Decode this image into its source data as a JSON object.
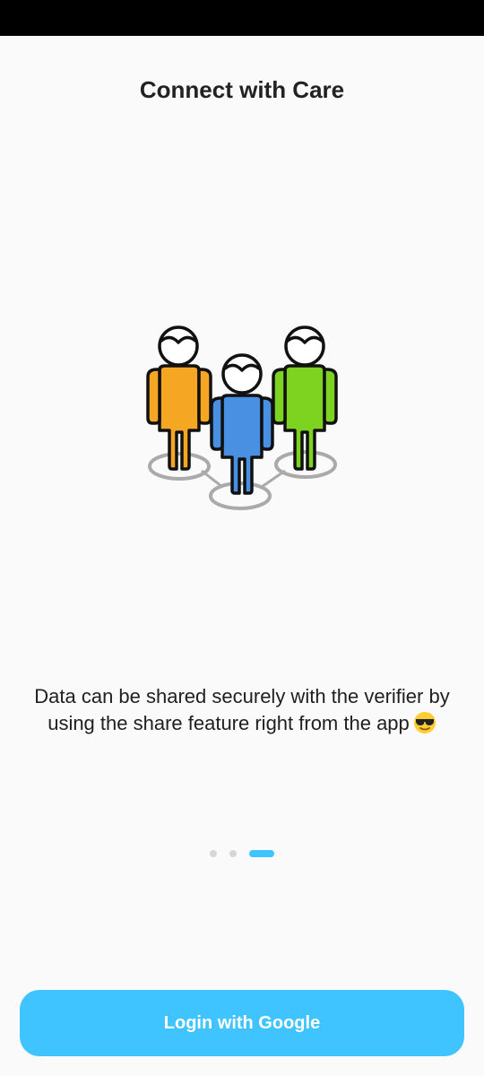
{
  "header": {
    "title": "Connect with Care"
  },
  "illustration": {
    "icon": "people-network-icon",
    "person_colors": [
      "#f5a623",
      "#4a90e2",
      "#7ed321"
    ]
  },
  "body": {
    "description": "Data can be shared securely with the verifier by using the share feature right from the app",
    "emoji_icon": "sunglasses-emoji-icon"
  },
  "pager": {
    "total": 3,
    "active_index": 2
  },
  "actions": {
    "login_label": "Login with Google"
  },
  "colors": {
    "accent": "#40c4ff",
    "background": "#fafafa",
    "status_bar": "#000000"
  }
}
